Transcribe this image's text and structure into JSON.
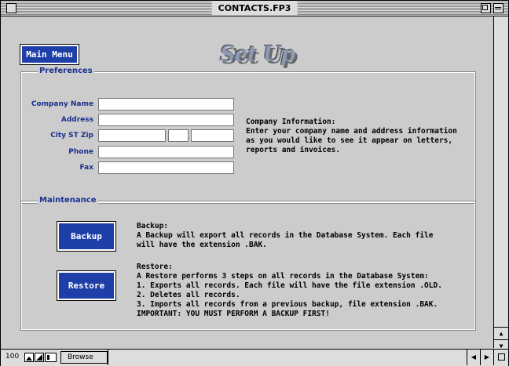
{
  "window": {
    "title": "CONTACTS.FP3"
  },
  "header": {
    "main_menu_label": "Main Menu",
    "page_title": "Set Up"
  },
  "preferences": {
    "group_label": "Preferences",
    "fields": {
      "company_name": {
        "label": "Company Name",
        "value": ""
      },
      "address": {
        "label": "Address",
        "value": ""
      },
      "city_st_zip": {
        "label": "City ST Zip",
        "city": "",
        "state": "",
        "zip": ""
      },
      "phone": {
        "label": "Phone",
        "value": ""
      },
      "fax": {
        "label": "Fax",
        "value": ""
      }
    },
    "info_title": "Company Information:",
    "info_lines": [
      "Enter your company name and address information",
      "as you would like to see it appear on letters,",
      "reports and invoices."
    ]
  },
  "maintenance": {
    "group_label": "Maintenance",
    "backup_button": "Backup",
    "backup_title": "Backup:",
    "backup_lines": [
      "A Backup will export all records in the Database System. Each file",
      "will have the extension .BAK."
    ],
    "restore_button": "Restore",
    "restore_title": "Restore:",
    "restore_lines": [
      "A Restore performs 3 steps on all records in the Database System:",
      "1. Exports all records. Each file will have the file extension .OLD.",
      "2. Deletes all records.",
      "3. Imports all records from a previous backup, file extension .BAK.",
      "IMPORTANT: YOU MUST PERFORM A BACKUP FIRST!"
    ]
  },
  "statusbar": {
    "zoom": "100",
    "mode": "Browse"
  },
  "icons": {
    "close": "close-box-icon",
    "zoom": "zoom-box-icon",
    "collapse": "collapse-box-icon",
    "scroll_up": "scroll-up-arrow-icon",
    "scroll_down": "scroll-down-arrow-icon",
    "scroll_left": "scroll-left-arrow-icon",
    "scroll_right": "scroll-right-arrow-icon"
  },
  "colors": {
    "button_fill": "#1e3fa8",
    "label_text": "#1a2f8f",
    "background": "#cccccc"
  }
}
